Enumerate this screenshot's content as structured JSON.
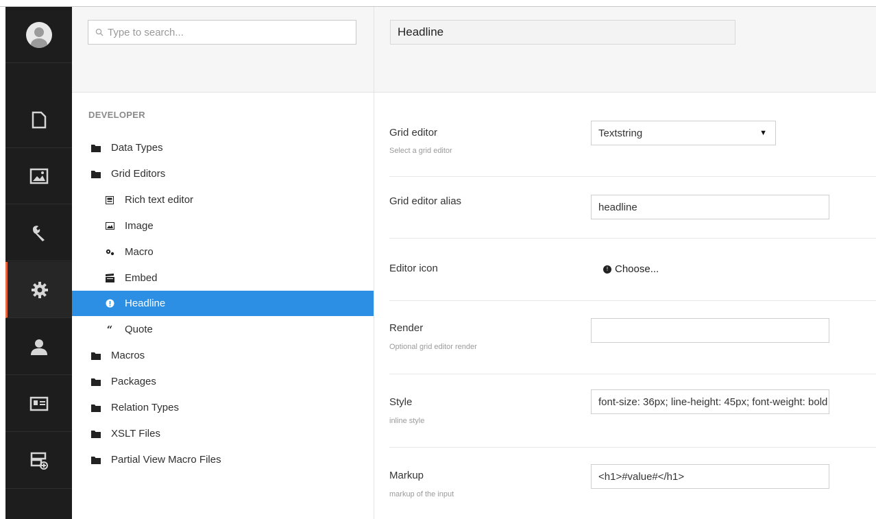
{
  "search": {
    "placeholder": "Type to search..."
  },
  "tree": {
    "section_title": "DEVELOPER",
    "nodes": [
      {
        "label": "Data Types",
        "icon": "folder-icon"
      },
      {
        "label": "Grid Editors",
        "icon": "folder-icon"
      },
      {
        "label": "Rich text editor",
        "icon": "rich-text-icon"
      },
      {
        "label": "Image",
        "icon": "image-icon"
      },
      {
        "label": "Macro",
        "icon": "settings-icon"
      },
      {
        "label": "Embed",
        "icon": "movie-icon"
      },
      {
        "label": "Headline",
        "icon": "info-icon",
        "selected": true
      },
      {
        "label": "Quote",
        "icon": "quote-icon"
      },
      {
        "label": "Macros",
        "icon": "folder-icon"
      },
      {
        "label": "Packages",
        "icon": "folder-icon"
      },
      {
        "label": "Relation Types",
        "icon": "folder-icon"
      },
      {
        "label": "XSLT Files",
        "icon": "folder-icon"
      },
      {
        "label": "Partial View Macro Files",
        "icon": "folder-icon"
      }
    ]
  },
  "editor": {
    "name": "Headline",
    "fields": {
      "grid_editor": {
        "label": "Grid editor",
        "description": "Select a grid editor",
        "value": "Textstring"
      },
      "alias": {
        "label": "Grid editor alias",
        "value": "headline"
      },
      "icon": {
        "label": "Editor icon",
        "value": "Choose..."
      },
      "render": {
        "label": "Render",
        "description": "Optional grid editor render",
        "value": ""
      },
      "style": {
        "label": "Style",
        "description": "inline style",
        "value": "font-size: 36px; line-height: 45px; font-weight: bold"
      },
      "markup": {
        "label": "Markup",
        "description": "markup of the input",
        "value": "<h1>#value#</h1>"
      }
    }
  },
  "colors": {
    "rail": "#1d1d1d",
    "selected": "#2d8fe3",
    "active_accent": "#e8643a"
  }
}
